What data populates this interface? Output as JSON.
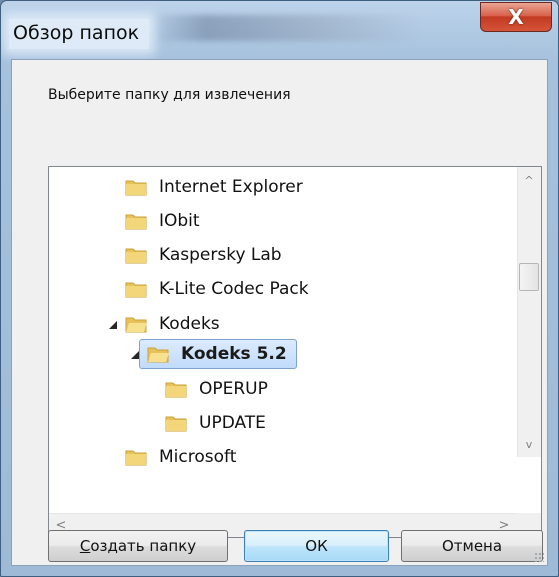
{
  "window": {
    "title": "Обзор папок",
    "close_symbol": "X"
  },
  "dialog": {
    "prompt": "Выберите папку для извлечения"
  },
  "tree": {
    "items": [
      {
        "label": "Internet Explorer",
        "level": 1,
        "expander": "collapsed"
      },
      {
        "label": "IObit",
        "level": 1,
        "expander": "collapsed"
      },
      {
        "label": "Kaspersky Lab",
        "level": 1,
        "expander": "collapsed"
      },
      {
        "label": "K-Lite Codec Pack",
        "level": 1,
        "expander": "collapsed"
      },
      {
        "label": "Kodeks",
        "level": 1,
        "expander": "expanded"
      },
      {
        "label": "Kodeks 5.2",
        "level": 2,
        "expander": "expanded",
        "selected": true
      },
      {
        "label": "OPERUP",
        "level": 3,
        "expander": "none"
      },
      {
        "label": "UPDATE",
        "level": 3,
        "expander": "none"
      },
      {
        "label": "Microsoft",
        "level": 1,
        "expander": "collapsed"
      }
    ]
  },
  "scrollbars": {
    "up_arrow": "^",
    "down_arrow": "v",
    "left_arrow": "<",
    "right_arrow": ">"
  },
  "buttons": {
    "new_folder": "Создать папку",
    "ok": "ОК",
    "cancel": "Отмена"
  },
  "colors": {
    "selection_fill": "#c1dbfc",
    "selection_border": "#7da2ce",
    "close_button": "#c23a21",
    "folder": "#e8c15a"
  }
}
